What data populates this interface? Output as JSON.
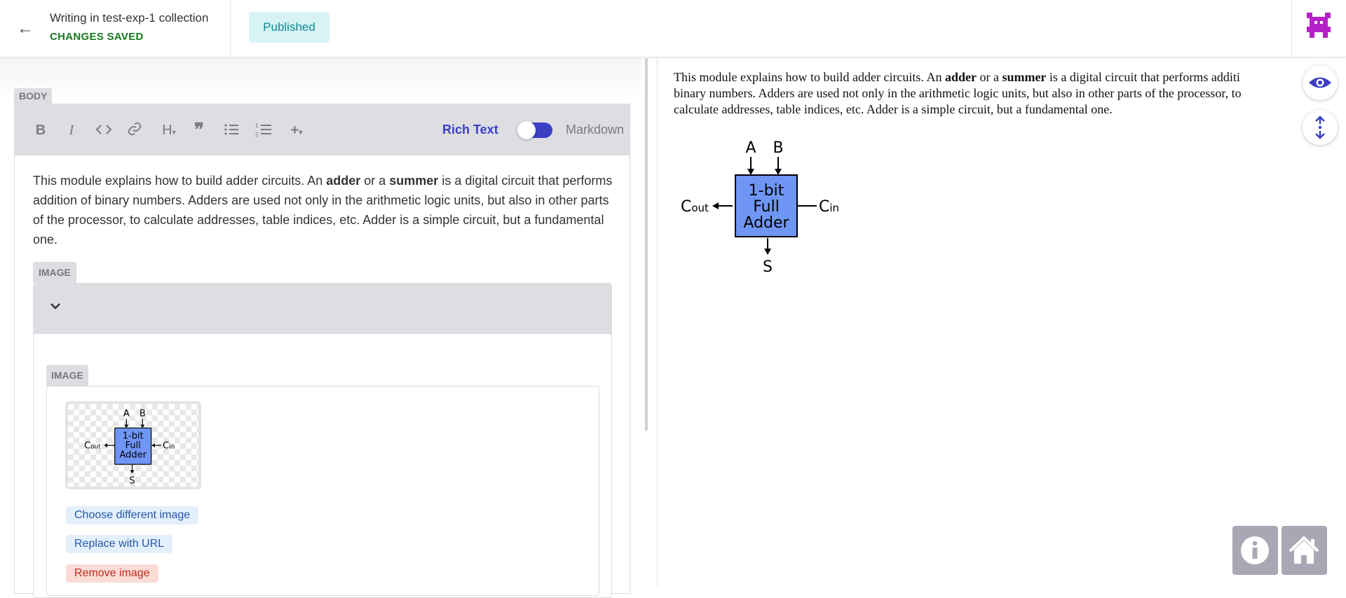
{
  "header": {
    "back_glyph": "←",
    "title": "Writing in test-exp-1 collection",
    "status": "CHANGES SAVED",
    "publish_label": "Published"
  },
  "editor": {
    "body_label": "BODY",
    "toolbar": {
      "buttons": [
        "bold",
        "italic",
        "code",
        "link",
        "heading",
        "quote",
        "bulleted-list",
        "numbered-list",
        "add"
      ],
      "rich_text_label": "Rich Text",
      "markdown_label": "Markdown",
      "mode": "Rich Text"
    },
    "paragraph": {
      "part1": "This module explains how to build adder circuits. An ",
      "bold1": "adder",
      "part2": " or a ",
      "bold2": "summer",
      "part3": " is a digital circuit that performs addition of binary numbers. Adders are used not only in the arithmetic logic units, but also in other parts of the processor, to calculate addresses, table indices, etc. Adder is a simple circuit, but a fundamental one."
    },
    "image_block": {
      "label": "IMAGE",
      "inner_label": "IMAGE",
      "actions": {
        "choose": "Choose different image",
        "replace": "Replace with URL",
        "remove": "Remove image"
      }
    }
  },
  "diagram": {
    "a": "A",
    "b": "B",
    "line1": "1-bit",
    "line2": "Full",
    "line3": "Adder",
    "cout_c": "C",
    "cout_sub": "out",
    "cin_c": "C",
    "cin_sub": "in",
    "s": "S"
  },
  "preview": {
    "part1": "This module explains how to build adder circuits. An ",
    "bold1": "adder",
    "part2": " or a ",
    "bold2": "summer",
    "part3": " is a digital circuit that performs additi",
    "line2": "binary numbers. Adders are used not only in the arithmetic logic units, but also in other parts of the processor, to",
    "line3": "calculate addresses, table indices, etc. Adder is a simple circuit, but a fundamental one."
  },
  "colors": {
    "accent": "#3a3fc4",
    "saved_green": "#157a1c",
    "adder_fill": "#6f96f4",
    "logo": "#b520c8"
  }
}
